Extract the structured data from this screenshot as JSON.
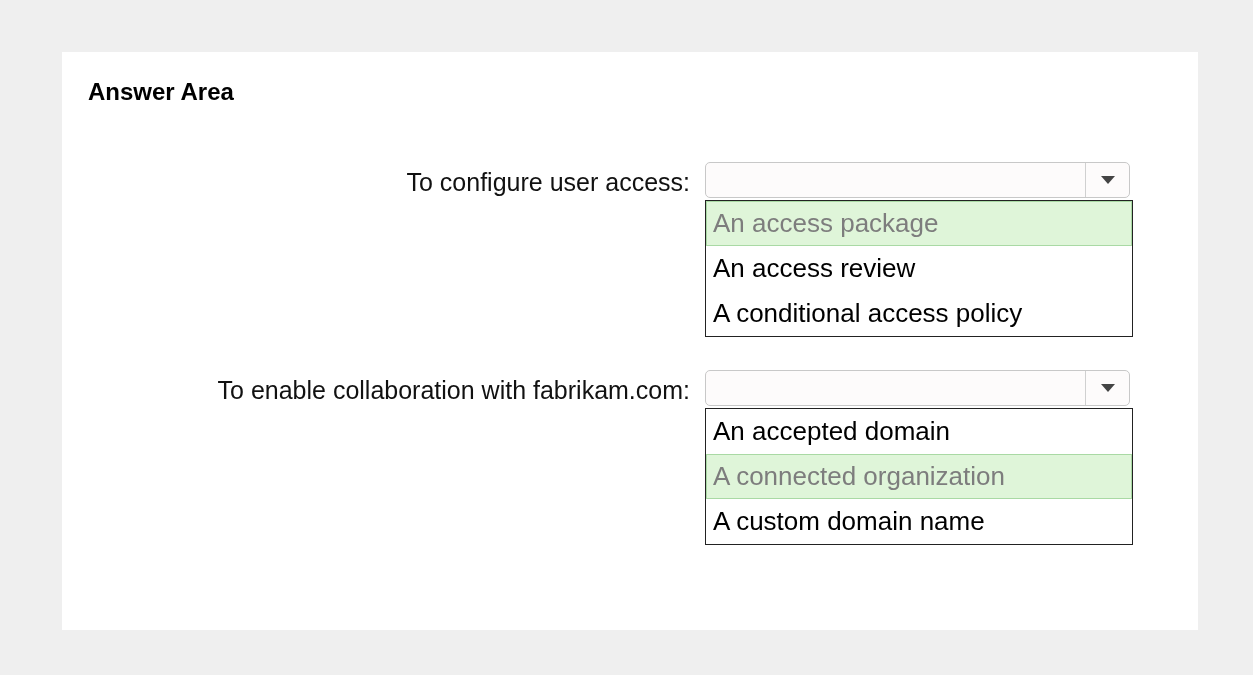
{
  "title": "Answer Area",
  "questions": [
    {
      "label": "To configure user access:",
      "options": [
        {
          "text": "An access package",
          "selected": true
        },
        {
          "text": "An access review",
          "selected": false
        },
        {
          "text": "A conditional access policy",
          "selected": false
        }
      ]
    },
    {
      "label": "To enable collaboration with fabrikam.com:",
      "options": [
        {
          "text": "An accepted domain",
          "selected": false
        },
        {
          "text": "A connected organization",
          "selected": true
        },
        {
          "text": "A custom domain name",
          "selected": false
        }
      ]
    }
  ]
}
